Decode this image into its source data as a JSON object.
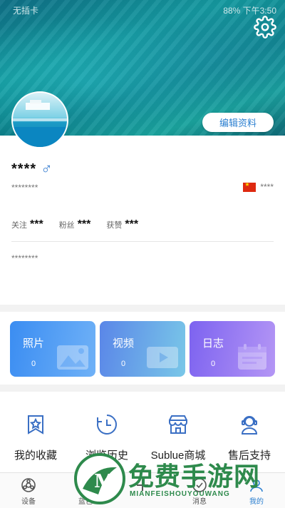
{
  "status_bar": {
    "carrier": "无插卡",
    "right": "88%  下午3:50"
  },
  "header": {
    "edit_profile": "编辑资料"
  },
  "profile": {
    "nickname": "****",
    "gender_symbol": "♂",
    "user_id": "********",
    "region": "****",
    "stats": [
      {
        "label": "关注",
        "value": "***"
      },
      {
        "label": "粉丝",
        "value": "***"
      },
      {
        "label": "获赞",
        "value": "***"
      }
    ],
    "signature": "********"
  },
  "tiles": [
    {
      "label": "照片",
      "count": "0",
      "icon": "photo-icon"
    },
    {
      "label": "视频",
      "count": "0",
      "icon": "video-icon"
    },
    {
      "label": "日志",
      "count": "0",
      "icon": "calendar-icon"
    }
  ],
  "shortcuts": [
    {
      "label": "我的收藏",
      "icon": "favorite-star-icon"
    },
    {
      "label": "浏览历史",
      "icon": "history-clock-icon"
    },
    {
      "label": "Sublue商城",
      "icon": "store-icon"
    },
    {
      "label": "售后支持",
      "icon": "support-headset-icon"
    }
  ],
  "nav": [
    {
      "label": "设备",
      "icon": "device-icon"
    },
    {
      "label": "蓝色",
      "icon": "discover-icon"
    },
    {
      "label": "",
      "icon": "add-icon"
    },
    {
      "label": "消息",
      "icon": "message-icon"
    },
    {
      "label": "我的",
      "icon": "profile-icon"
    }
  ],
  "watermark": {
    "text": "免费手游网",
    "sub": "MIANFEISHOUYOUWANG"
  },
  "colors": {
    "accent": "#2b7fd0",
    "tile1": "#3b8df2",
    "tile2": "#5a86e8",
    "tile3": "#7d63f0"
  }
}
